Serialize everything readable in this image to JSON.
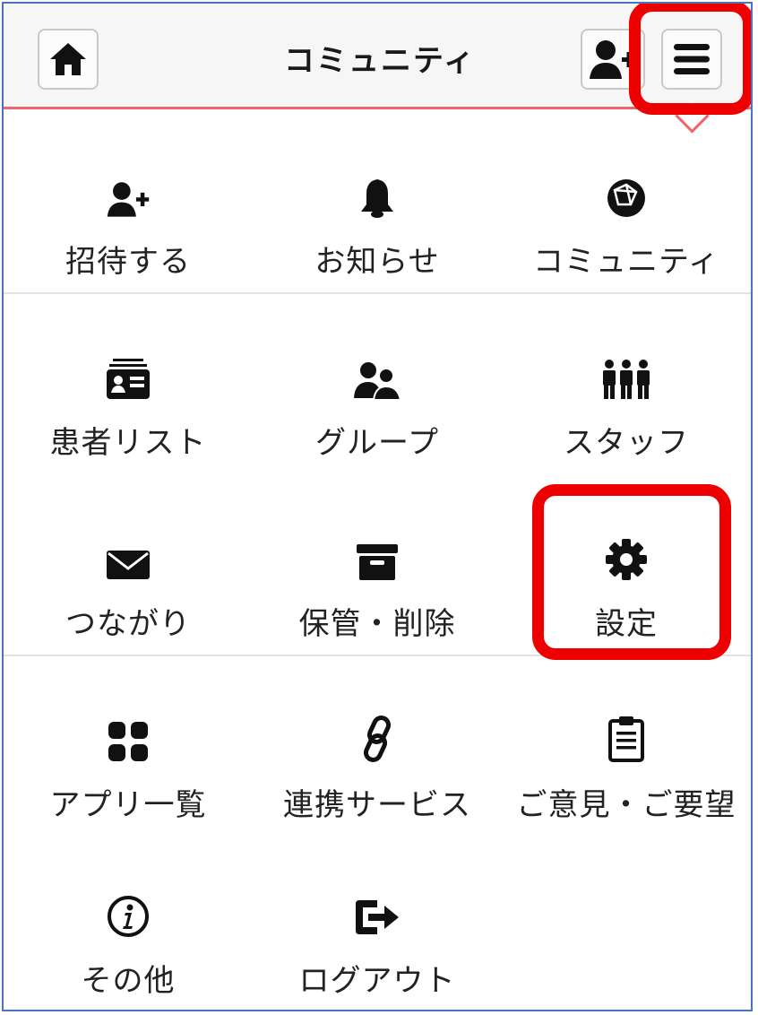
{
  "header": {
    "title": "コミュニティ",
    "home_icon": "home-icon",
    "add_user_icon": "add-user-icon",
    "menu_icon": "hamburger-menu-icon"
  },
  "colors": {
    "accent_line": "#f0646c",
    "highlight": "#ee0000",
    "frame": "#4a74c0"
  },
  "menu": [
    {
      "label": "招待する",
      "icon": "invite-user-icon"
    },
    {
      "label": "お知らせ",
      "icon": "bell-icon"
    },
    {
      "label": "コミュニティ",
      "icon": "globe-icon"
    },
    {
      "label": "患者リスト",
      "icon": "patient-card-icon"
    },
    {
      "label": "グループ",
      "icon": "group-icon"
    },
    {
      "label": "スタッフ",
      "icon": "staff-icon"
    },
    {
      "label": "つながり",
      "icon": "envelope-icon"
    },
    {
      "label": "保管・削除",
      "icon": "archive-box-icon"
    },
    {
      "label": "設定",
      "icon": "gear-icon"
    },
    {
      "label": "アプリ一覧",
      "icon": "apps-grid-icon"
    },
    {
      "label": "連携サービス",
      "icon": "link-icon"
    },
    {
      "label": "ご意見・ご要望",
      "icon": "clipboard-icon"
    },
    {
      "label": "その他",
      "icon": "info-icon"
    },
    {
      "label": "ログアウト",
      "icon": "logout-icon"
    }
  ]
}
